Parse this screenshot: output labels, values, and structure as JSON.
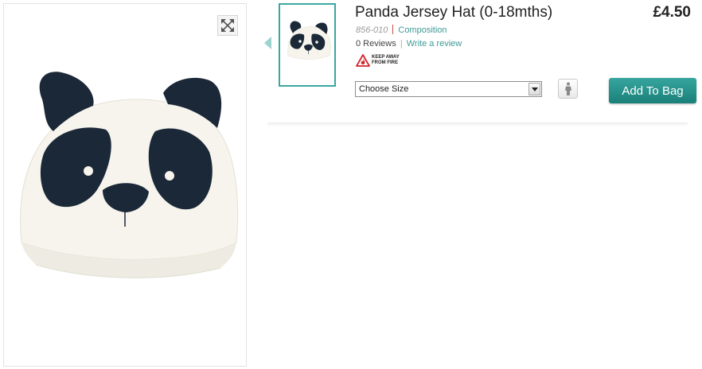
{
  "product": {
    "title": "Panda Jersey Hat (0-18mths)",
    "price": "£4.50",
    "code": "856-010",
    "composition_link": "Composition",
    "reviews": "0 Reviews",
    "write_review_link": "Write a review",
    "fire_warning": {
      "line1": "KEEP AWAY",
      "line2": "FROM FIRE"
    }
  },
  "size_select": {
    "value": "Choose Size"
  },
  "add_to_bag": {
    "label": "Add To Bag"
  },
  "colors": {
    "accent": "#1f8b84",
    "link": "#3f9a96",
    "panda_black": "#1b2838",
    "hat_white": "#f5f3ea"
  },
  "icons": {
    "expand": "expand-arrows-icon",
    "size_guide": "person-figure-icon",
    "select_arrow": "chevron-down-icon",
    "fire": "fire-warning-icon"
  }
}
